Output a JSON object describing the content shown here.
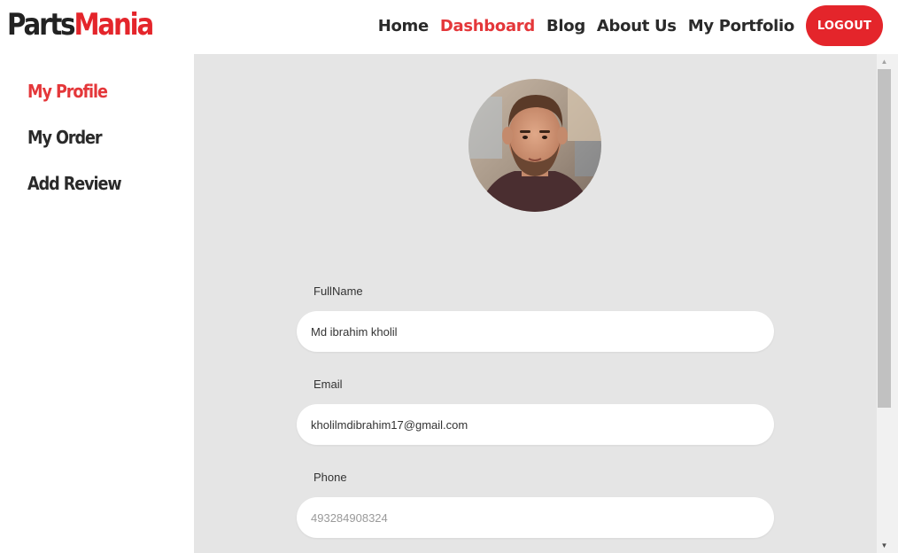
{
  "brand": {
    "part1": "Parts",
    "part2": "Mania"
  },
  "nav": {
    "items": [
      {
        "label": "Home"
      },
      {
        "label": "Dashboard"
      },
      {
        "label": "Blog"
      },
      {
        "label": "About Us"
      },
      {
        "label": "My Portfolio"
      }
    ],
    "logout_label": "LOGOUT"
  },
  "sidebar": {
    "items": [
      {
        "label": "My Profile"
      },
      {
        "label": "My Order"
      },
      {
        "label": "Add Review"
      }
    ]
  },
  "profile": {
    "fullname_label": "FullName",
    "fullname_value": "Md ibrahim kholil",
    "email_label": "Email",
    "email_value": "kholilmdibrahim17@gmail.com",
    "phone_label": "Phone",
    "phone_placeholder": "493284908324"
  },
  "colors": {
    "accent": "#e4252b",
    "active_link": "#e4373a",
    "panel_bg": "#e5e5e5"
  },
  "icons": {
    "scroll_up": "arrow-up-icon",
    "scroll_down": "arrow-down-icon"
  }
}
